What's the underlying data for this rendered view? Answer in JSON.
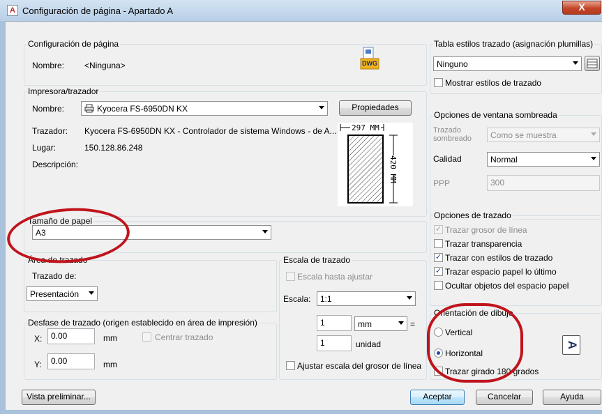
{
  "window": {
    "title": "Configuración de página - Apartado A",
    "close_glyph": "X"
  },
  "page_setup": {
    "group_label": "Configuración de página",
    "name_label": "Nombre:",
    "name_value": "<Ninguna>",
    "dwg_icon_text": "DWG"
  },
  "plotter": {
    "group_label": "Impresora/trazador",
    "name_label": "Nombre:",
    "name_value": "Kyocera FS-6950DN KX",
    "properties_button": "Propiedades",
    "plotter_label": "Trazador:",
    "plotter_value": "Kyocera FS-6950DN KX - Controlador de sistema Windows - de A...",
    "location_label": "Lugar:",
    "location_value": "150.128.86.248",
    "description_label": "Descripción:",
    "paper_width": "297  MM",
    "paper_height": "420  MM"
  },
  "paper_size": {
    "group_label": "Tamaño de papel",
    "value": "A3"
  },
  "plot_area": {
    "group_label": "Área de trazado",
    "what_label": "Trazado de:",
    "what_value": "Presentación"
  },
  "plot_scale": {
    "group_label": "Escala de trazado",
    "fit_label": "Escala hasta ajustar",
    "scale_label": "Escala:",
    "scale_value": "1:1",
    "value1": "1",
    "unit1": "mm",
    "equals": "=",
    "value2": "1",
    "unit2": "unidad",
    "lineweights_label": "Ajustar escala del grosor de línea"
  },
  "plot_offset": {
    "group_label": "Desfase de trazado (origen establecido en área de impresión)",
    "x_label": "X:",
    "x_value": "0.00",
    "x_unit": "mm",
    "center_label": "Centrar trazado",
    "y_label": "Y:",
    "y_value": "0.00",
    "y_unit": "mm"
  },
  "plot_style_table": {
    "group_label": "Tabla estilos trazado (asignación plumillas)",
    "value": "Ninguno",
    "display_label": "Mostrar estilos de trazado"
  },
  "shaded_viewport": {
    "group_label": "Opciones de ventana sombreada",
    "shade_label": "Trazado sombreado",
    "shade_value": "Como se muestra",
    "quality_label": "Calidad",
    "quality_value": "Normal",
    "dpi_label": "PPP",
    "dpi_value": "300"
  },
  "plot_options": {
    "group_label": "Opciones de trazado",
    "items": [
      {
        "label": "Trazar grosor de línea",
        "checked": true,
        "enabled": false
      },
      {
        "label": "Trazar transparencia",
        "checked": false,
        "enabled": true
      },
      {
        "label": "Trazar con estilos de trazado",
        "checked": true,
        "enabled": true
      },
      {
        "label": "Trazar espacio papel lo último",
        "checked": true,
        "enabled": true
      },
      {
        "label": "Ocultar objetos del espacio papel",
        "checked": false,
        "enabled": true
      }
    ]
  },
  "orientation": {
    "group_label": "Orientación de dibujo",
    "portrait": "Vertical",
    "landscape": "Horizontal",
    "upside_down": "Trazar girado 180 grados",
    "icon_letter": "A"
  },
  "footer": {
    "preview": "Vista preliminar...",
    "ok": "Aceptar",
    "cancel": "Cancelar",
    "help": "Ayuda"
  },
  "colors": {
    "annotation_red": "#c0141c",
    "title_gradient_top": "#d3e3f3"
  }
}
